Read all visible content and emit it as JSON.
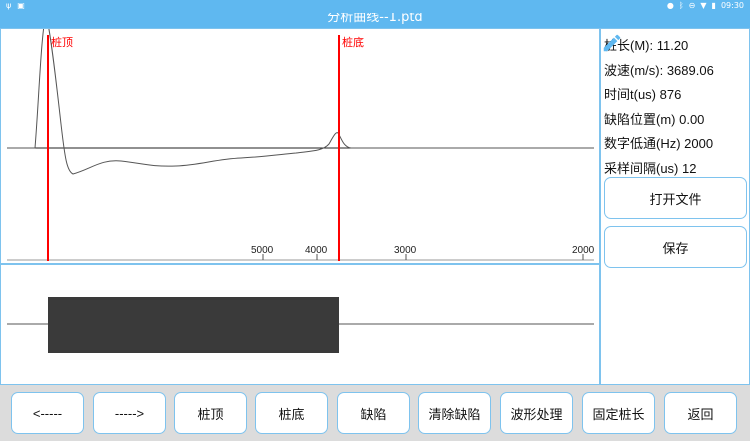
{
  "status_bar": {
    "left_icons": [
      "usb-icon",
      "image-icon"
    ],
    "time": "09:30",
    "right_icons": [
      "location-icon",
      "bluetooth-icon",
      "dnd-icon",
      "wifi-icon",
      "battery-icon"
    ]
  },
  "window": {
    "title": "分析曲线--1.ptd"
  },
  "waveform": {
    "markers": [
      {
        "label": "桩顶",
        "color": "#ff0000"
      },
      {
        "label": "桩底",
        "color": "#ff0000"
      }
    ],
    "axis_ticks": [
      "5000",
      "4000",
      "3000",
      "2000"
    ]
  },
  "info": {
    "length": {
      "label": "桩长(M): ",
      "value": "11.20"
    },
    "velocity": {
      "label": "波速(m/s): ",
      "value": "3689.06"
    },
    "time": {
      "label": "时间t(us) ",
      "value": "876"
    },
    "defect_position": {
      "label": "缺陷位置(m) ",
      "value": "0.00"
    },
    "lowpass": {
      "label": "数字低通(Hz) ",
      "value": "2000"
    },
    "sample_interval": {
      "label": "采样间隔(us) ",
      "value": "12"
    }
  },
  "side_buttons": {
    "open_file": "打开文件",
    "save": "保存"
  },
  "bottom_buttons": [
    "<-----",
    "----->",
    "桩顶",
    "桩底",
    "缺陷",
    "清除缺陷",
    "波形处理",
    "固定桩长",
    "返回"
  ],
  "colors": {
    "accent": "#5fb8f0",
    "border": "#7ec3ee",
    "marker": "#ff0000",
    "defect_block": "#3a3a3a"
  }
}
